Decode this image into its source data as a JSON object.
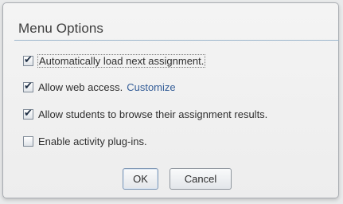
{
  "dialog": {
    "title": "Menu Options",
    "options": [
      {
        "label": "Automatically load next assignment.",
        "checked": true
      },
      {
        "label": "Allow web access.",
        "link": "Customize",
        "checked": true
      },
      {
        "label": "Allow students to browse their assignment results.",
        "checked": true
      },
      {
        "label": "Enable activity plug-ins.",
        "checked": false
      }
    ],
    "buttons": {
      "ok": "OK",
      "cancel": "Cancel"
    },
    "check_glyph": "✔"
  },
  "colors": {
    "link": "#355e98",
    "title_rule": "#9db6cc"
  }
}
